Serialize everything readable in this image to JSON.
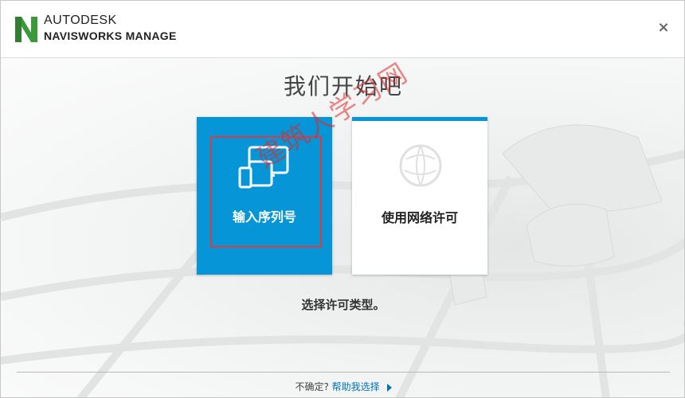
{
  "header": {
    "brand_company": "AUTODESK",
    "brand_product": "NAVISWORKS MANAGE",
    "logo_icon": "navisworks-n-logo",
    "close_icon": "close-icon"
  },
  "main": {
    "title": "我们开始吧",
    "subtitle": "选择许可类型。",
    "cards": [
      {
        "label": "输入序列号",
        "icon": "devices-icon",
        "selected": true
      },
      {
        "label": "使用网络许可",
        "icon": "network-globe-icon",
        "selected": false
      }
    ]
  },
  "overlay": {
    "watermark": "建筑人学习网"
  },
  "footer": {
    "question": "不确定?",
    "help_link": "帮助我选择"
  },
  "colors": {
    "accent": "#0696d7",
    "highlight": "#e03a3a",
    "link": "#0073b8",
    "logo_green": "#3a9a3a"
  }
}
